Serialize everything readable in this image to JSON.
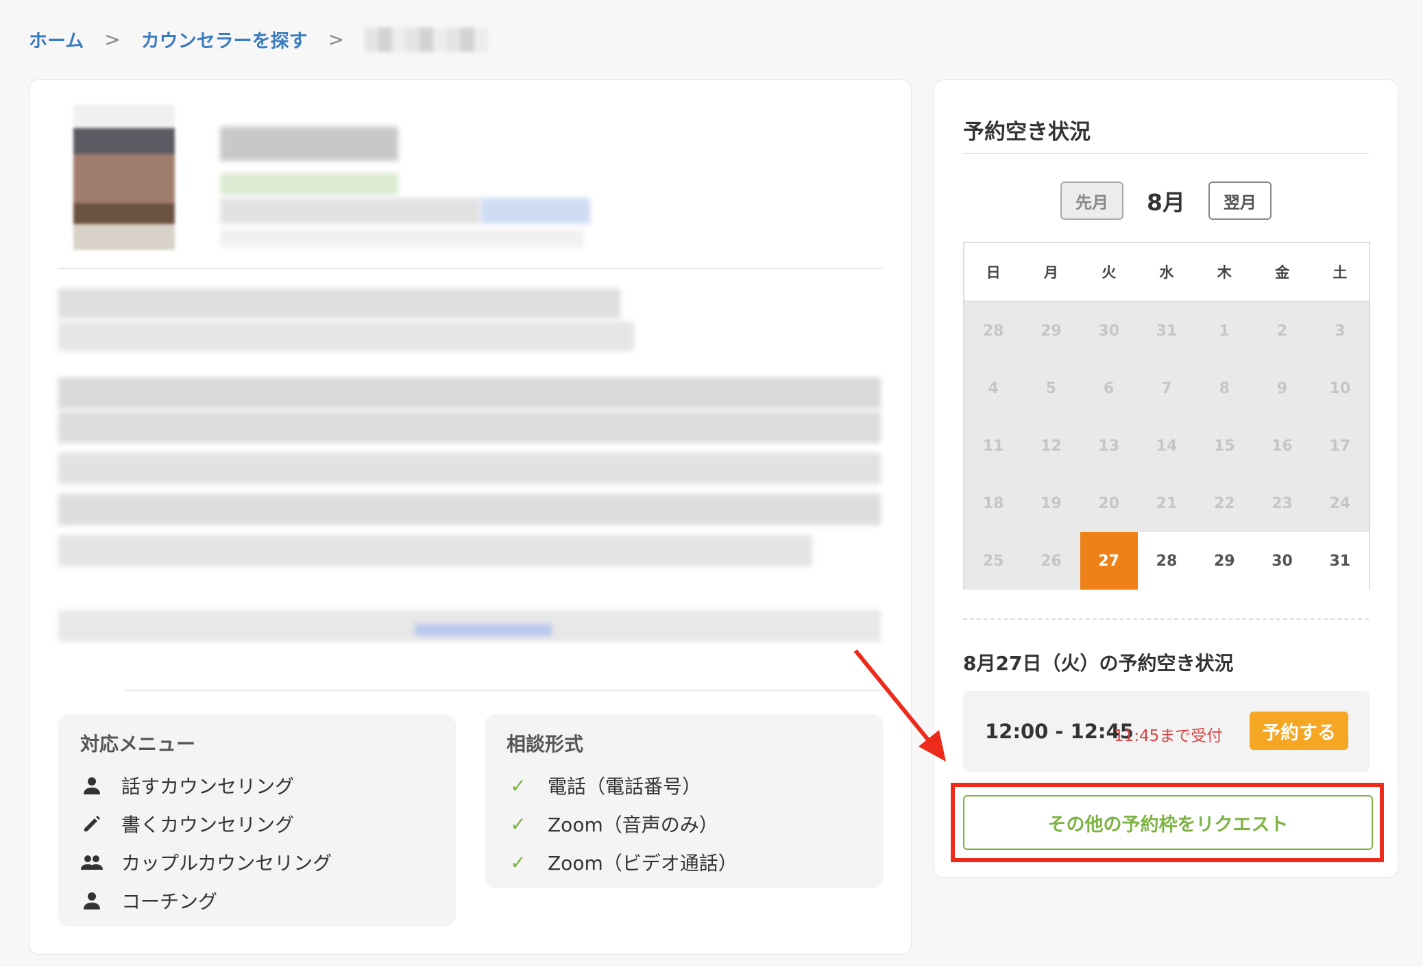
{
  "breadcrumb": {
    "home": "ホーム",
    "search": "カウンセラーを探す",
    "separator": ">"
  },
  "menu": {
    "title": "対応メニュー",
    "items": [
      {
        "label": "話すカウンセリング",
        "icon": "person-icon"
      },
      {
        "label": "書くカウンセリング",
        "icon": "pencil-icon"
      },
      {
        "label": "カップルカウンセリング",
        "icon": "people-icon"
      },
      {
        "label": "コーチング",
        "icon": "person-icon"
      }
    ]
  },
  "format": {
    "title": "相談形式",
    "items": [
      {
        "label": "電話（電話番号）",
        "icon": "check-icon"
      },
      {
        "label": "Zoom（音声のみ）",
        "icon": "check-icon"
      },
      {
        "label": "Zoom（ビデオ通話）",
        "icon": "check-icon"
      }
    ]
  },
  "availability": {
    "title": "予約空き状況",
    "prev_label": "先月",
    "next_label": "翌月",
    "month_label": "8月",
    "weekdays": [
      "日",
      "月",
      "火",
      "水",
      "木",
      "金",
      "土"
    ],
    "weeks": [
      [
        {
          "d": "28",
          "s": "past"
        },
        {
          "d": "29",
          "s": "past"
        },
        {
          "d": "30",
          "s": "past"
        },
        {
          "d": "31",
          "s": "past"
        },
        {
          "d": "1",
          "s": "past"
        },
        {
          "d": "2",
          "s": "past"
        },
        {
          "d": "3",
          "s": "past"
        }
      ],
      [
        {
          "d": "4",
          "s": "past"
        },
        {
          "d": "5",
          "s": "past"
        },
        {
          "d": "6",
          "s": "past"
        },
        {
          "d": "7",
          "s": "past"
        },
        {
          "d": "8",
          "s": "past"
        },
        {
          "d": "9",
          "s": "past"
        },
        {
          "d": "10",
          "s": "past"
        }
      ],
      [
        {
          "d": "11",
          "s": "past"
        },
        {
          "d": "12",
          "s": "past"
        },
        {
          "d": "13",
          "s": "past"
        },
        {
          "d": "14",
          "s": "past"
        },
        {
          "d": "15",
          "s": "past"
        },
        {
          "d": "16",
          "s": "past"
        },
        {
          "d": "17",
          "s": "past"
        }
      ],
      [
        {
          "d": "18",
          "s": "past"
        },
        {
          "d": "19",
          "s": "past"
        },
        {
          "d": "20",
          "s": "past"
        },
        {
          "d": "21",
          "s": "past"
        },
        {
          "d": "22",
          "s": "past"
        },
        {
          "d": "23",
          "s": "past"
        },
        {
          "d": "24",
          "s": "past"
        }
      ],
      [
        {
          "d": "25",
          "s": "past"
        },
        {
          "d": "26",
          "s": "past"
        },
        {
          "d": "27",
          "s": "selected"
        },
        {
          "d": "28",
          "s": "future"
        },
        {
          "d": "29",
          "s": "future"
        },
        {
          "d": "30",
          "s": "future"
        },
        {
          "d": "31",
          "s": "future"
        }
      ]
    ],
    "slot_title": "8月27日（火）の予約空き状況",
    "slot": {
      "time": "12:00 - 12:45",
      "deadline": "11:45まで受付",
      "book_label": "予約する"
    },
    "request_label": "その他の予約枠をリクエスト"
  },
  "colors": {
    "link": "#3b7bbf",
    "selected_day": "#ee8217",
    "book_button": "#f5a623",
    "request_green": "#7cb342",
    "highlight_red": "#ee2a1a"
  }
}
